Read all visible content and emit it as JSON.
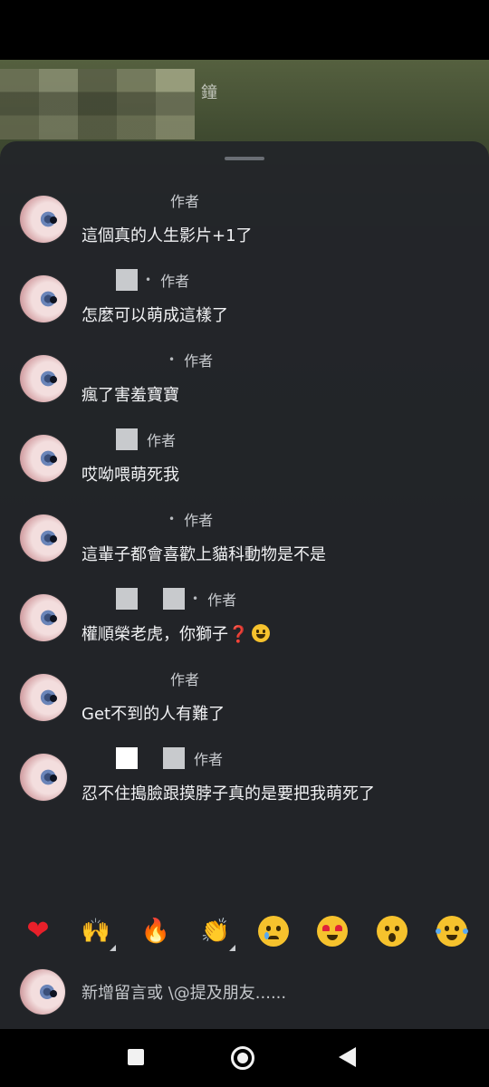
{
  "video": {
    "title_fragment": "鐘"
  },
  "comments": [
    {
      "name_redactions": [],
      "show_dot": false,
      "badge": "作者",
      "text": "這個真的人生影片+1了"
    },
    {
      "name_redactions": [
        "gray"
      ],
      "show_dot": true,
      "badge": "作者",
      "text": "怎麼可以萌成這樣了"
    },
    {
      "name_redactions": [],
      "show_dot": true,
      "badge": "作者",
      "text": "瘋了害羞寶寶"
    },
    {
      "name_redactions": [
        "gray"
      ],
      "show_dot": false,
      "badge": "作者",
      "text": "哎呦喂萌死我"
    },
    {
      "name_redactions": [],
      "show_dot": true,
      "badge": "作者",
      "text": "這輩子都會喜歡上貓科動物是不是"
    },
    {
      "name_redactions": [
        "gray",
        "gray"
      ],
      "show_dot": true,
      "badge": "作者",
      "text": "權順榮老虎，你獅子❓",
      "has_smiley": true
    },
    {
      "name_redactions": [],
      "show_dot": false,
      "badge": "作者",
      "text": "Get不到的人有難了"
    },
    {
      "name_redactions": [
        "white",
        "gray"
      ],
      "show_dot": false,
      "badge": "作者",
      "text": "忍不住搗臉跟摸脖子真的是要把我萌死了"
    }
  ],
  "reactions": [
    "heart-emoji",
    "raising-hands-emoji",
    "fire-emoji",
    "clapping-hands-emoji",
    "crying-face-emoji",
    "heart-eyes-emoji",
    "surprised-face-emoji",
    "tears-of-joy-emoji"
  ],
  "composer": {
    "placeholder": "新增留言或 \\@提及朋友......"
  }
}
